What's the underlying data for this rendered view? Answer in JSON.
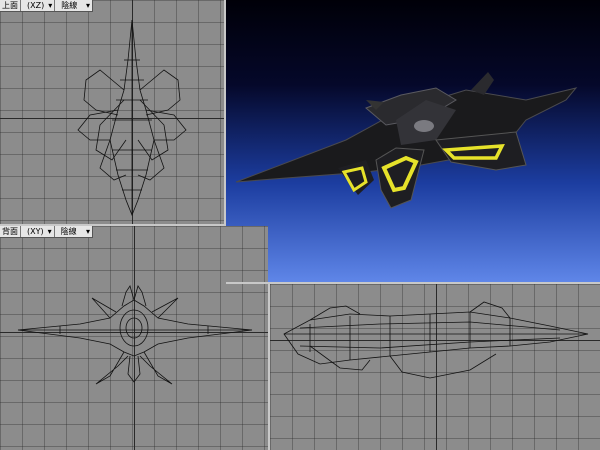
{
  "viewports": {
    "top": {
      "view_label": "上面",
      "axis_label": "(XZ)",
      "shading_label": "陰線"
    },
    "back": {
      "view_label": "背面",
      "axis_label": "(XY)",
      "shading_label": "陰線"
    }
  },
  "colors": {
    "viewport_bg": "#8c8c8c",
    "grid_line": "#5a5a5a",
    "render_sky_top": "#000008",
    "render_sky_bottom": "#5f86e8",
    "glow_accent": "#e6e22a"
  }
}
